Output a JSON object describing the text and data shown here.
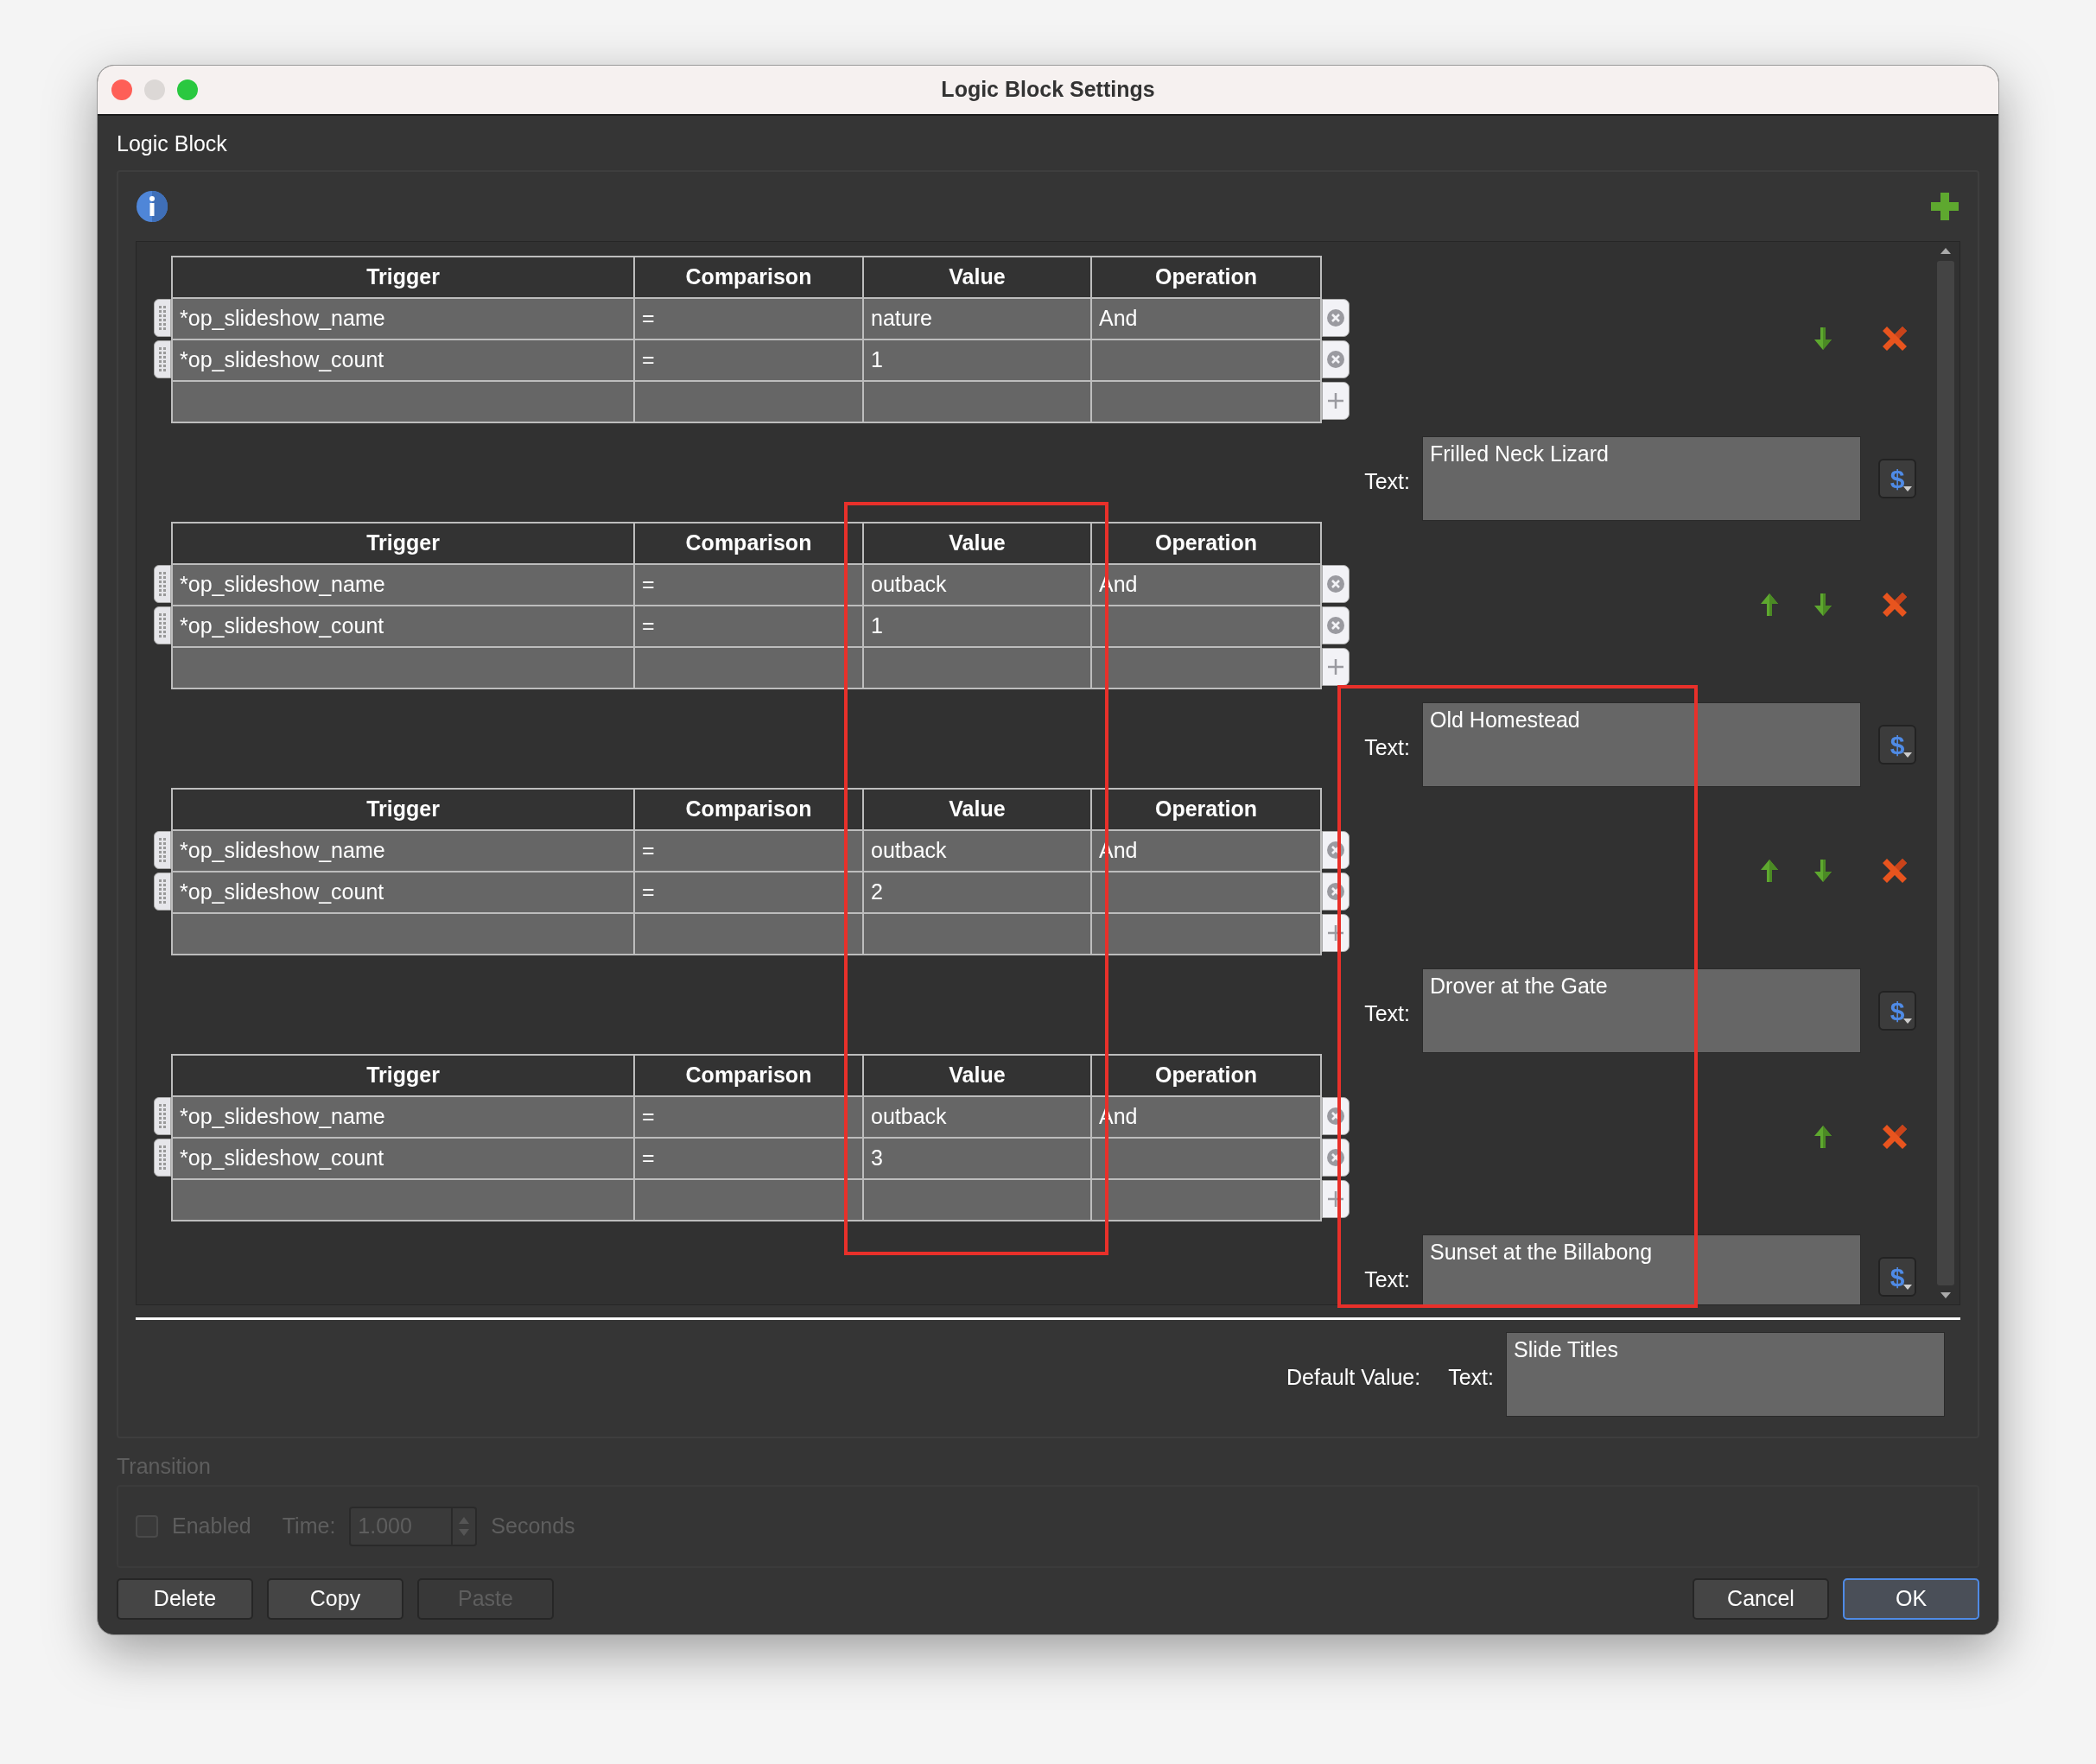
{
  "window": {
    "title": "Logic Block Settings"
  },
  "group_title": "Logic Block",
  "blocks": [
    {
      "columns": [
        "Trigger",
        "Comparison",
        "Value",
        "Operation"
      ],
      "rows": [
        [
          "*op_slideshow_name",
          "=",
          "nature",
          "And"
        ],
        [
          "*op_slideshow_count",
          "=",
          "1",
          ""
        ]
      ],
      "move_up": false,
      "move_down": true,
      "text_label": "Text:",
      "text": "Frilled Neck Lizard",
      "symbol": "$"
    },
    {
      "columns": [
        "Trigger",
        "Comparison",
        "Value",
        "Operation"
      ],
      "rows": [
        [
          "*op_slideshow_name",
          "=",
          "outback",
          "And"
        ],
        [
          "*op_slideshow_count",
          "=",
          "1",
          ""
        ]
      ],
      "move_up": true,
      "move_down": true,
      "text_label": "Text:",
      "text": "Old Homestead",
      "symbol": "$"
    },
    {
      "columns": [
        "Trigger",
        "Comparison",
        "Value",
        "Operation"
      ],
      "rows": [
        [
          "*op_slideshow_name",
          "=",
          "outback",
          "And"
        ],
        [
          "*op_slideshow_count",
          "=",
          "2",
          ""
        ]
      ],
      "move_up": true,
      "move_down": true,
      "text_label": "Text:",
      "text": "Drover at the Gate",
      "symbol": "$"
    },
    {
      "columns": [
        "Trigger",
        "Comparison",
        "Value",
        "Operation"
      ],
      "rows": [
        [
          "*op_slideshow_name",
          "=",
          "outback",
          "And"
        ],
        [
          "*op_slideshow_count",
          "=",
          "3",
          ""
        ]
      ],
      "move_up": true,
      "move_down": false,
      "text_label": "Text:",
      "text": "Sunset at the Billabong",
      "symbol": "$"
    }
  ],
  "default_value": {
    "label": "Default Value:",
    "text_label": "Text:",
    "text": "Slide Titles"
  },
  "transition": {
    "title": "Transition",
    "disabled": true,
    "enabled_label": "Enabled",
    "checked": false,
    "time_label": "Time:",
    "time": "1.000",
    "unit": "Seconds"
  },
  "left_buttons": [
    {
      "label": "Delete",
      "disabled": false,
      "default": false
    },
    {
      "label": "Copy",
      "disabled": false,
      "default": false
    },
    {
      "label": "Paste",
      "disabled": true,
      "default": false
    }
  ],
  "right_buttons": [
    {
      "label": "Cancel",
      "disabled": false,
      "default": false
    },
    {
      "label": "OK",
      "disabled": false,
      "default": true
    }
  ],
  "highlights": {
    "value_column": true,
    "text_column": true
  }
}
